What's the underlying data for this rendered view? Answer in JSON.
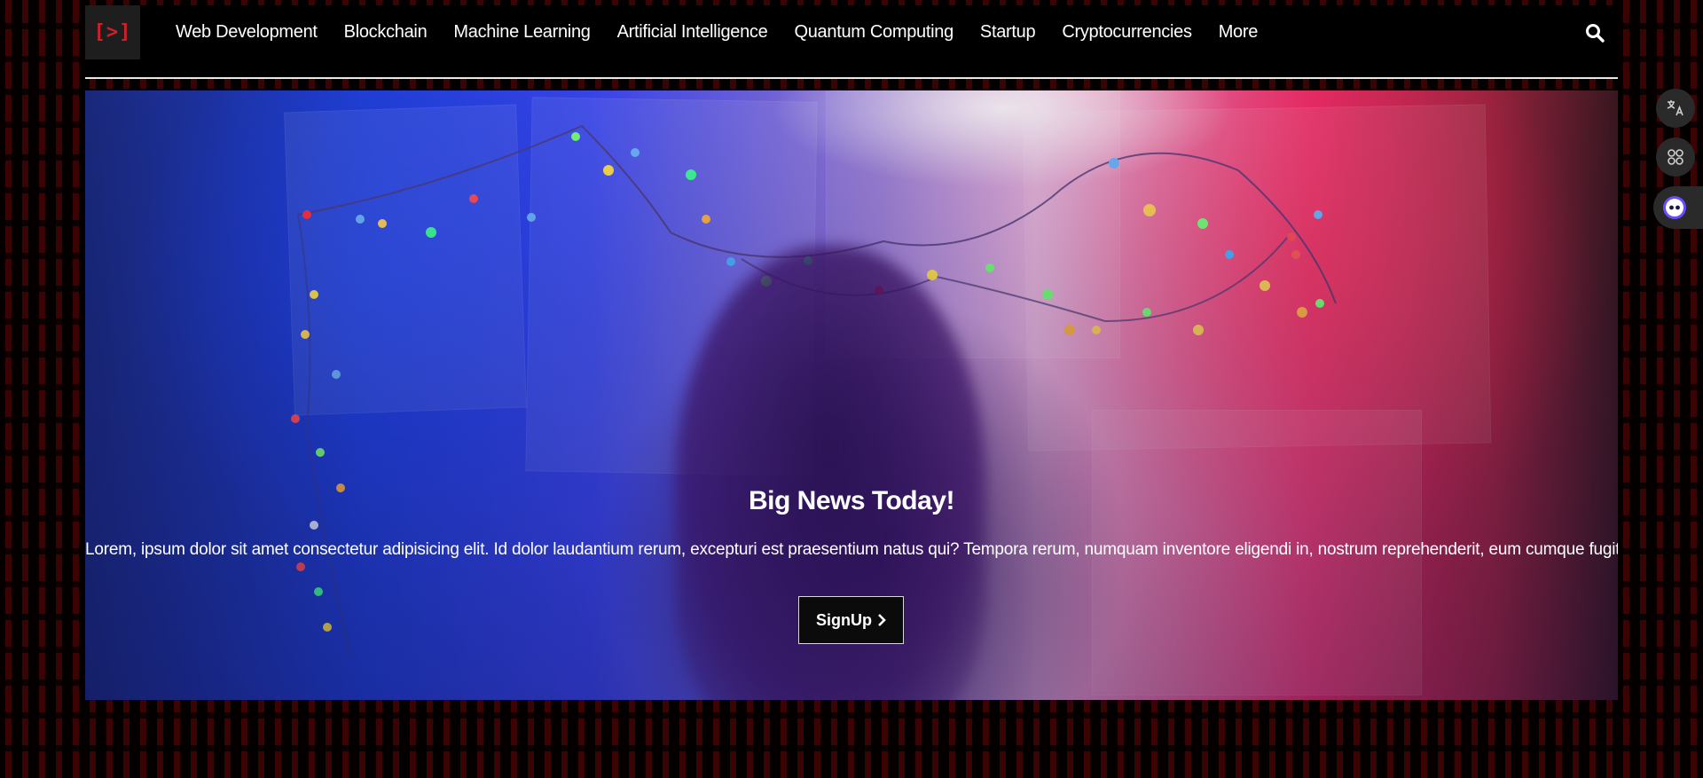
{
  "brand": {
    "logo_text": "[>]",
    "accent_color": "#d11f2a"
  },
  "nav": {
    "items": [
      {
        "label": "Web Development"
      },
      {
        "label": "Blockchain"
      },
      {
        "label": "Machine Learning"
      },
      {
        "label": "Artificial Intelligence"
      },
      {
        "label": "Quantum Computing"
      },
      {
        "label": "Startup"
      },
      {
        "label": "Cryptocurrencies"
      },
      {
        "label": "More"
      }
    ],
    "search_icon": "search-icon"
  },
  "hero": {
    "title": "Big News Today!",
    "text": "Lorem, ipsum dolor sit amet consectetur adipisicing elit. Id dolor laudantium rerum, excepturi est praesentium natus qui? Tempora rerum, numquam inventore eligendi in, nostrum reprehenderit, eum cumque fugit eaque similique!",
    "button_label": "SignUp",
    "button_icon": "chevron-right-icon"
  },
  "side_widgets": {
    "icons": [
      "translate-icon",
      "apps-icon",
      "assistant-icon"
    ]
  }
}
